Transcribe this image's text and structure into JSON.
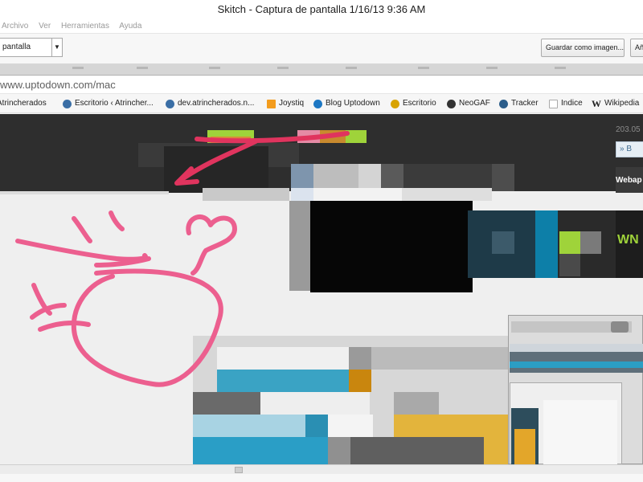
{
  "window": {
    "title": "Skitch - Captura de pantalla 1/16/13 9:36 AM"
  },
  "menu": {
    "items": [
      "Archivo",
      "Ver",
      "Herramientas",
      "Ayuda"
    ]
  },
  "toolbar": {
    "mode_select": "pantalla",
    "save_label": "Guardar como imagen...",
    "add_label": "Añ"
  },
  "browser": {
    "address": "www.uptodown.com/mac",
    "bookmarks": [
      {
        "label": "Atrincherados",
        "icon": "tree-icon",
        "color": "#6a8f3b"
      },
      {
        "label": "Escritorio ‹ Atrincher...",
        "icon": "wordpress-icon",
        "color": "#3a6ea5"
      },
      {
        "label": "dev.atrincherados.n...",
        "icon": "wordpress-icon",
        "color": "#3a6ea5"
      },
      {
        "label": "Joystiq",
        "icon": "joystiq-icon",
        "color": "#f39c1d"
      },
      {
        "label": "Blog Uptodown",
        "icon": "uptodown-icon",
        "color": "#1c77c3"
      },
      {
        "label": "Escritorio",
        "icon": "duck-icon",
        "color": "#d8a300"
      },
      {
        "label": "NeoGAF",
        "icon": "neogaf-icon",
        "color": "#333333"
      },
      {
        "label": "Tracker",
        "icon": "tracker-icon",
        "color": "#2b5d8a"
      },
      {
        "label": "Indice",
        "icon": "page-icon",
        "color": "#bfbfbf"
      },
      {
        "label": "Wikipedia",
        "icon": "wikipedia-icon",
        "color": "#222222"
      }
    ]
  },
  "page": {
    "side_ip": "203.05",
    "side_button": "B",
    "side_label": "Webap",
    "banner_text": "WN"
  },
  "colors": {
    "annotation": "#ec5f8f",
    "annotation_arrow": "#e0345e",
    "pixel_accent_blue": "#2a8fb3",
    "pixel_accent_green": "#9fd33a",
    "pixel_accent_yellow": "#e3b43c"
  }
}
